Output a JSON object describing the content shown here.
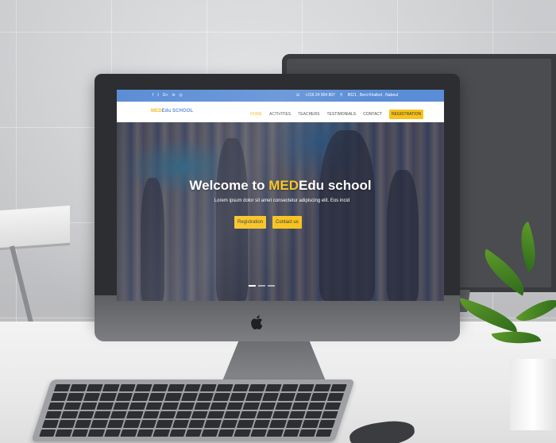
{
  "topbar": {
    "social_icons": [
      "facebook-icon",
      "twitter-icon",
      "google-plus-icon",
      "linkedin-icon",
      "instagram-icon"
    ],
    "social_glyphs": [
      "f",
      "t",
      "G+",
      "in",
      "◎"
    ],
    "phone_icon": "☏",
    "phone": "+216 24 904 807",
    "location_icon": "⚲",
    "address": "8021 , Beni Khalled , Nabeul"
  },
  "navbar": {
    "brand_highlight": "MED",
    "brand_rest": "Edu SCHOOL",
    "items": [
      {
        "label": "HOME",
        "active": true
      },
      {
        "label": "ACTIVITIES"
      },
      {
        "label": "TEACHERS"
      },
      {
        "label": "TESTIMONIALS"
      },
      {
        "label": "CONTACT"
      }
    ],
    "registration_label": "REGISTRATION"
  },
  "hero": {
    "title_before": "Welcome to ",
    "title_highlight": "MED",
    "title_after": "Edu school",
    "subtitle": "Lorem ipsum dolor sit amet consectetur adipiscing elit. Eos incid",
    "registration_button": "Registration",
    "contact_button": "Contact us",
    "slides": 3,
    "active_slide": 1
  },
  "colors": {
    "accent": "#f7c21c",
    "topbar": "#5b8dd6"
  }
}
